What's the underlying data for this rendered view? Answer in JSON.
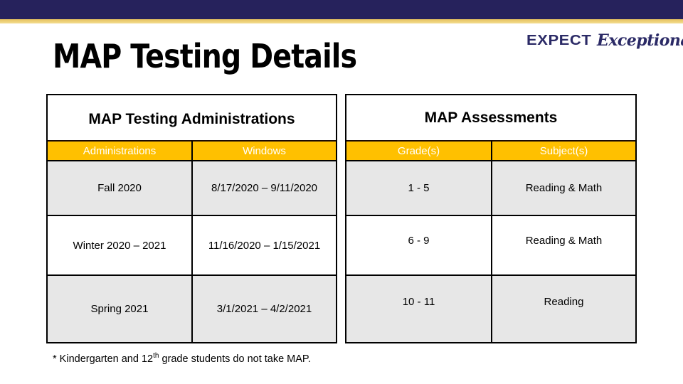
{
  "slide": {
    "title": "MAP Testing Details",
    "logo": {
      "word1": "EXPECT",
      "word2": "Exceptional"
    },
    "colors": {
      "top_bar": "#26225c",
      "accent_gold": "#ffc000",
      "row_shade": "#e7e7e7"
    }
  },
  "administrations_table": {
    "caption": "MAP Testing Administrations",
    "headers": [
      "Administrations",
      "Windows"
    ],
    "rows": [
      [
        "Fall 2020",
        "8/17/2020 – 9/11/2020"
      ],
      [
        "Winter 2020 – 2021",
        "11/16/2020 – 1/15/2021"
      ],
      [
        "Spring 2021",
        "3/1/2021 – 4/2/2021"
      ]
    ]
  },
  "assessments_table": {
    "caption": "MAP Assessments",
    "headers": [
      "Grade(s)",
      "Subject(s)"
    ],
    "rows": [
      [
        "1 - 5",
        "Reading & Math"
      ],
      [
        "6 - 9",
        "Reading & Math"
      ],
      [
        "10 - 11",
        "Reading"
      ]
    ]
  },
  "footnote": {
    "prefix": "* Kindergarten and 12",
    "superscript": "th",
    "suffix": " grade students do not take MAP."
  }
}
